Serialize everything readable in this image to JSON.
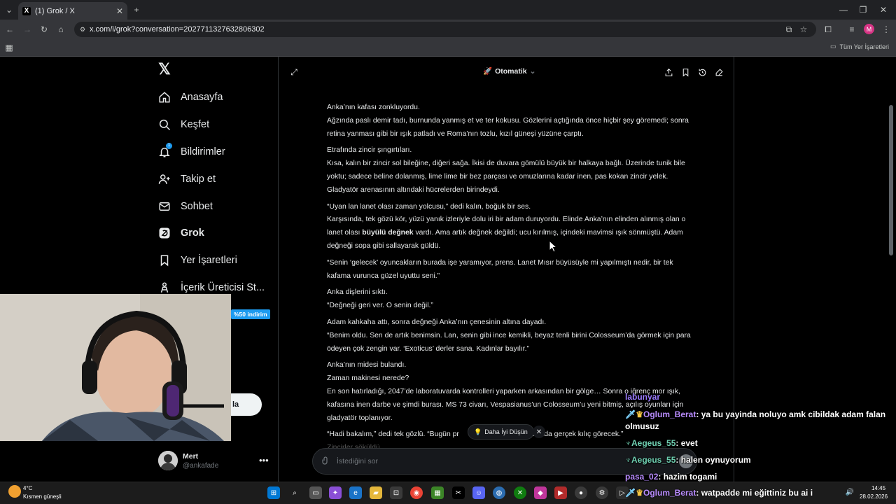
{
  "browser": {
    "tab_title": "(1) Grok / X",
    "url": "x.com/i/grok?conversation=2027711327632806302",
    "bookmarks_label": "Tüm Yer İşaretleri"
  },
  "sidebar": {
    "items": [
      {
        "label": "Anasayfa",
        "icon": "home-icon"
      },
      {
        "label": "Keşfet",
        "icon": "search-icon"
      },
      {
        "label": "Bildirimler",
        "icon": "bell-icon"
      },
      {
        "label": "Takip et",
        "icon": "follow-icon"
      },
      {
        "label": "Sohbet",
        "icon": "mail-icon"
      },
      {
        "label": "Grok",
        "icon": "grok-icon"
      },
      {
        "label": "Yer İşaretleri",
        "icon": "bookmark-icon"
      },
      {
        "label": "İçerik Üreticisi St...",
        "icon": "creator-icon"
      }
    ],
    "notification_count": "1",
    "promo_badge": "%50 indirim",
    "post_button": "la"
  },
  "account": {
    "name": "Mert",
    "handle": "@ankafade"
  },
  "grok": {
    "mode_label": "Otomatik",
    "story": [
      [
        "Anka’nın kafası zonkluyordu.",
        "Ağzında paslı demir tadı, burnunda yanmış et ve ter kokusu. Gözlerini açtığında önce hiçbir şey göremedi; sonra retina yanması gibi bir ışık patladı ve Roma’nın tozlu, kızıl güneşi yüzüne çarptı."
      ],
      [
        "Etrafında zincir şıngırtıları.",
        "Kısa, kalın bir zincir sol bileğine, diğeri sağa. İkisi de duvara gömülü büyük bir halkaya bağlı. Üzerinde tunik bile yoktu; sadece beline dolanmış, lime lime bir bez parçası ve omuzlarına kadar inen, pas kokan zincir yelek. Gladyatör arenasının altındaki hücrelerden birindeydi."
      ],
      [
        "“Uyan lan lanet olası zaman yolcusu,” dedi kalın, boğuk bir ses.",
        "Karşısında, tek gözü kör, yüzü yanık izleriyle dolu iri bir adam duruyordu. Elinde Anka’nın elinden alınmış olan o lanet olası "
      ],
      [
        "“Senin ‘gelecek’ oyuncakların burada işe yaramıyor, prens. Lanet Mısır büyüsüyle mi yapılmıştı nedir, bir tek kafama vurunca güzel uyuttu seni.”"
      ],
      [
        "Anka dişlerini sıktı.",
        "“Değneği geri ver. O senin değil.”"
      ],
      [
        "Adam kahkaha attı, sonra değneği Anka’nın çenesinin altına dayadı.",
        "“Benim oldu. Sen de artık benimsin. Lan, senin gibi ince kemikli, beyaz tenli birini Colosseum’da görmek için para ödeyen çok zengin var. ‘Exoticus’ derler sana. Kadınlar bayılır.”"
      ],
      [
        "Anka’nın midesi bulandı.",
        "Zaman makinesi nerede?",
        "En son hatırladığı, 2047’de laboratuvarda kontrolleri yaparken arkasından bir gölge… Sonra o iğrenç mor ışık, kafasına inen darbe ve şimdi burası. MS 73 civarı, Vespasianus’un Colosseum’u yeni bitmiş, açılış oyunları için gladyatör toplanıyor."
      ],
      [
        "“Hadi bakalım,” dedi tek gözlü. “Bugün pr",
        "arın arenada gerçek kılıç görecek.”"
      ]
    ],
    "bold_phrase": "büyülü değnek",
    "after_bold": " vardı. Ama artık değnek değildi; ucu kırılmış, içindeki mavimsi ışık sönmüştü. Adam değneği sopa gibi sallayarak güldü.",
    "last_line_partial": "Zincirler söküldü.",
    "think_button": "Daha İyi Düşün",
    "input_placeholder": "İstediğini sor"
  },
  "chat_overlay": [
    {
      "user": "labunyar",
      "text": "",
      "color": "#9b7bff"
    },
    {
      "user": "Oglum_Berat",
      "text": ": ya bu yayinda noluyo amk cibildak adam falan olmusuz",
      "color": "#b98cff"
    },
    {
      "user": "Aegeus_55",
      "text": ": evet",
      "color": "#6fd0b2"
    },
    {
      "user": "Aegeus_55",
      "text": ": halen oynuyorum",
      "color": "#6fd0b2"
    },
    {
      "user": "pasa_02",
      "text": ": hazim togami",
      "color": "#b98cff"
    },
    {
      "user": "Oglum_Berat",
      "text": ": watpadde mi eğittiniz bu ai i",
      "color": "#b98cff"
    }
  ],
  "taskbar": {
    "temperature": "4°C",
    "weather": "Kısmen güneşli",
    "time": "14:45",
    "date": "28.02.2026"
  },
  "colors": {
    "accent": "#1d9bf0",
    "background": "#000000",
    "text": "#e7e9ea",
    "muted": "#71767b"
  }
}
